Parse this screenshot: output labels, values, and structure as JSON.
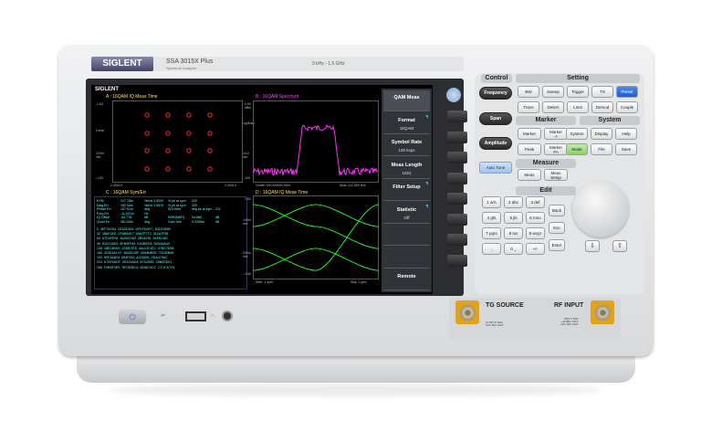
{
  "instrument": {
    "brand": "SIGLENT",
    "model": "SSA 3015X Plus",
    "subtitle": "Spectrum Analyzer",
    "freq_range": "9 kHz - 1.5 GHz"
  },
  "screen": {
    "brand": "SIGLENT",
    "trace_a": {
      "title": "A : 16QAM  IQ Meas Time",
      "y_top": "1.60",
      "y_label_2": "Const",
      "y_mid": "200m\n/div",
      "y_bot": "-1.60",
      "x_left": "-2.34413",
      "x_right": "2.34413"
    },
    "trace_b": {
      "title": "B : 16QAM  Spectrum",
      "y_top": "0.00\ndBm",
      "y_label_2": "Log/Mag",
      "y_mid": "10.0\n/div",
      "y_bot": "-100",
      "x_left": "Center 100.000000 MHz",
      "x_right": "Span 312.500 kHz"
    },
    "trace_c": {
      "title": "C : 16QAM  Sym/Err",
      "metrics": [
        [
          "EVM",
          "217.78m",
          "%rms 3.5020",
          "% pk at sym",
          "320"
        ],
        [
          "Mag Err",
          "182.06m",
          "%rms 3.5519",
          "% pk at sym",
          "320"
        ],
        [
          "Phase Err",
          "107.51m",
          "deg",
          "823.66m",
          "deg pk at sym",
          "211"
        ],
        [
          "Freq Err",
          "-11.021m",
          "Hz"
        ],
        [
          "IQ Offset",
          "-64.778",
          "dB",
          "SNR(MER)",
          "44.666",
          "dB"
        ],
        [
          "Quad Err",
          "381.69m",
          "deg",
          "Gain Imb",
          "3.0336m",
          "dB"
        ]
      ],
      "symbols": [
        "0  3EF92C64  221AE3D4  DFEFDDFC  83CE0699",
        "32  1B6F2E5  CFAB92E7  D667F7T3  312A7F56",
        "64  A7D4FE08  16A5CD62  2B24296  3AF8148C",
        "96  81D74AE5  8FB5FF83  EA3BED5  9D5A8A43",
        "128  38E24BD9  153807ED  AA1CE1EC  07BC7D55",
        "160  323E4A1CF  8A26218F  A9AB4B93  7313EB89",
        "192  5FE9A824  384F2A3  A225591  2DA479AC",
        "224  A7AF5ADF  0E443ADA  B7A269E  26B0DD01",
        "256  F0B5F4E9  7B75DBCA  5438C3CC  CC1F4CF6"
      ]
    },
    "trace_d": {
      "title": "D : 16QAM  IQ Meas Time",
      "y_top": "1.60",
      "y_mid": "140m\n/div",
      "y_label_3": "200m\n/div",
      "y_bot": "-1.60",
      "x_left": "Start -1 sym",
      "x_right": "Stop 1 sym"
    },
    "softkeys": [
      {
        "title": "QAM Meas",
        "value": ""
      },
      {
        "title": "Format",
        "value": "16QAM"
      },
      {
        "title": "Symbol Rate",
        "value": "100 ksps"
      },
      {
        "title": "Meas Length",
        "value": "1024"
      },
      {
        "title": "Filter Setup",
        "value": ""
      },
      {
        "title": "Statistic",
        "value": "Off"
      },
      {
        "title": "",
        "value": ""
      },
      {
        "title": "",
        "value": ""
      },
      {
        "title": "Remote",
        "value": ""
      }
    ]
  },
  "front_panel": {
    "control": {
      "title": "Control",
      "buttons": [
        "Frequency",
        "Span",
        "Amplitude",
        "Auto Tune"
      ]
    },
    "setting": {
      "title": "Setting",
      "buttons": [
        "BW",
        "Sweep",
        "Trigger",
        "TG",
        "Preset",
        "Trace",
        "Detect",
        "Limit",
        "Demod",
        "Couple"
      ]
    },
    "marker": {
      "title": "Marker",
      "buttons": [
        "Marker",
        "Marker\n->",
        "Peak",
        "Marker\nFn"
      ]
    },
    "system": {
      "title": "System",
      "buttons": [
        "System",
        "Display",
        "Help",
        "Mode",
        "File",
        "Save"
      ]
    },
    "measure": {
      "title": "Measure",
      "buttons": [
        "Meas",
        "Meas\nSetup"
      ]
    },
    "edit": {
      "title": "Edit",
      "buttons": [
        "1 a/A",
        "2 abc",
        "3 def",
        "4 ghi",
        "5 jkl",
        "6 mno",
        "7 pqrs",
        "8 tuv",
        "9 wxyz",
        ". ,",
        "0 _",
        "+/-",
        "Back",
        "Esc",
        "Enter"
      ]
    },
    "arrows": [
      "⇩",
      "⇧"
    ],
    "tg_source": "TG SOURCE",
    "rf_input": "RF INPUT",
    "tg_warn": "OUTPUT 50Ω\n±DC 50V MAX",
    "rf_warn": "INPUT 50Ω\n+30dBm MAX\n±DC 50V MAX",
    "power_icon": "⏻",
    "usb_icon": "⇌"
  },
  "colors": {
    "trace_a_dots": "#ff3020",
    "trace_b": "#ff30ff",
    "trace_d": "#22ff22",
    "table_text": "#5ff",
    "preset": "#1d5fd0",
    "mode": "#8ad06a"
  }
}
